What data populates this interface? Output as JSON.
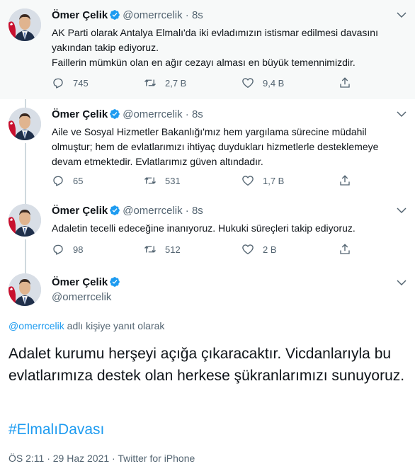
{
  "author": {
    "name": "Ömer Çelik",
    "handle": "@omerrcelik",
    "avatar_icon": "person-photo-avatar",
    "verified_icon": "verified-badge-icon"
  },
  "colors": {
    "accent": "#1d9bf0",
    "muted": "#536471",
    "text": "#0f1419",
    "thread_line": "#cfd9de",
    "highlight_bg": "#f7f9f9"
  },
  "tweets": [
    {
      "time": "8s",
      "lines": [
        "AK Parti olarak Antalya Elmalı'da iki evladımızın istismar edilmesi davasını",
        "yakından takip ediyoruz.",
        "Faillerin mümkün olan en ağır cezayı alması en büyük temennimizdir."
      ],
      "replies": "745",
      "retweets": "2,7 B",
      "likes": "9,4 B"
    },
    {
      "time": "8s",
      "lines": [
        "Aile ve Sosyal Hizmetler Bakanlığı'mız hem yargılama sürecine müdahil",
        "olmuştur; hem de evlatlarımızı ihtiyaç duydukları hizmetlerle desteklemeye",
        "devam etmektedir. Evlatlarımız güven altındadır."
      ],
      "replies": "65",
      "retweets": "531",
      "likes": "1,7 B"
    },
    {
      "time": "8s",
      "lines": [
        "Adaletin tecelli edeceğine inanıyoruz. Hukuki süreçleri takip ediyoruz."
      ],
      "replies": "98",
      "retweets": "512",
      "likes": "2 B"
    }
  ],
  "main_tweet": {
    "reply_to_link": "@omerrcelik",
    "reply_to_text": " adlı kişiye yanıt olarak",
    "body": "Adalet kurumu herşeyi açığa çıkaracaktır. Vicdanlarıyla bu evlatlarımıza destek olan herkese şükranlarımızı sunuyoruz.",
    "hashtag": "#ElmalıDavası",
    "meta": "ÖS 2:11 · 29 Haz 2021 · Twitter for iPhone"
  }
}
